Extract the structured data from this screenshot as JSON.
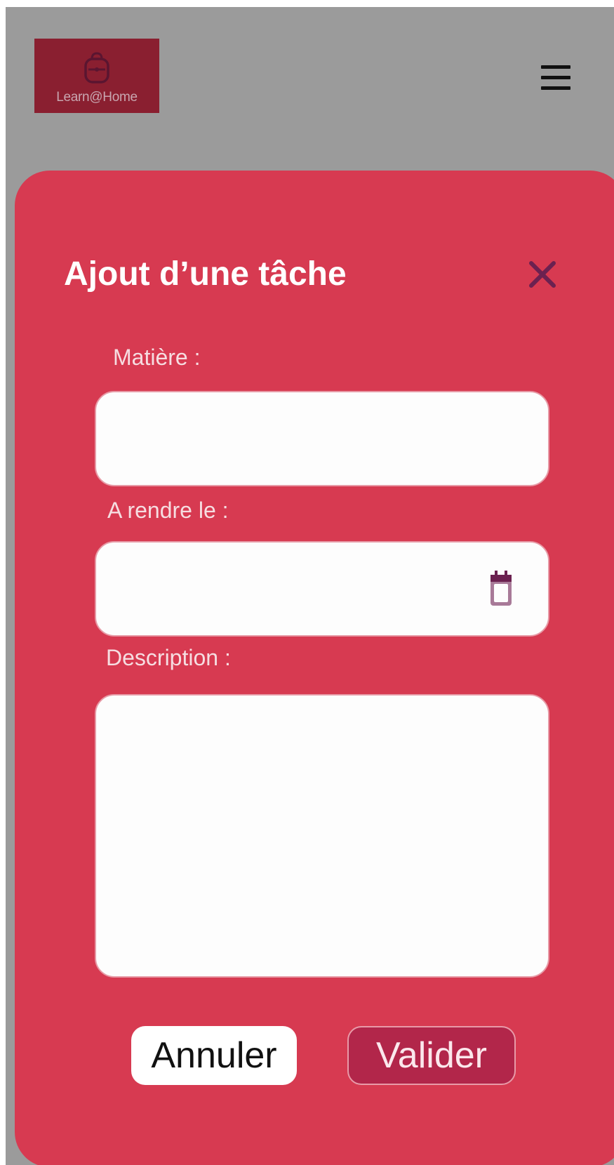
{
  "header": {
    "logo_text": "Learn@Home",
    "menu_icon": "hamburger-menu-icon"
  },
  "modal": {
    "title": "Ajout d’une tâche",
    "close_icon": "close-icon",
    "fields": {
      "subject_label": "Matière :",
      "subject_value": "",
      "due_label": "A rendre le :",
      "due_value": "",
      "description_label": "Description :",
      "description_value": ""
    },
    "cancel_label": "Annuler",
    "submit_label": "Valider"
  },
  "colors": {
    "backdrop": "#9b9b9b",
    "logo_bg": "#8a1f30",
    "modal_bg": "#d73a51",
    "submit_bg": "#b2264a",
    "icon_accent": "#6b2150"
  }
}
